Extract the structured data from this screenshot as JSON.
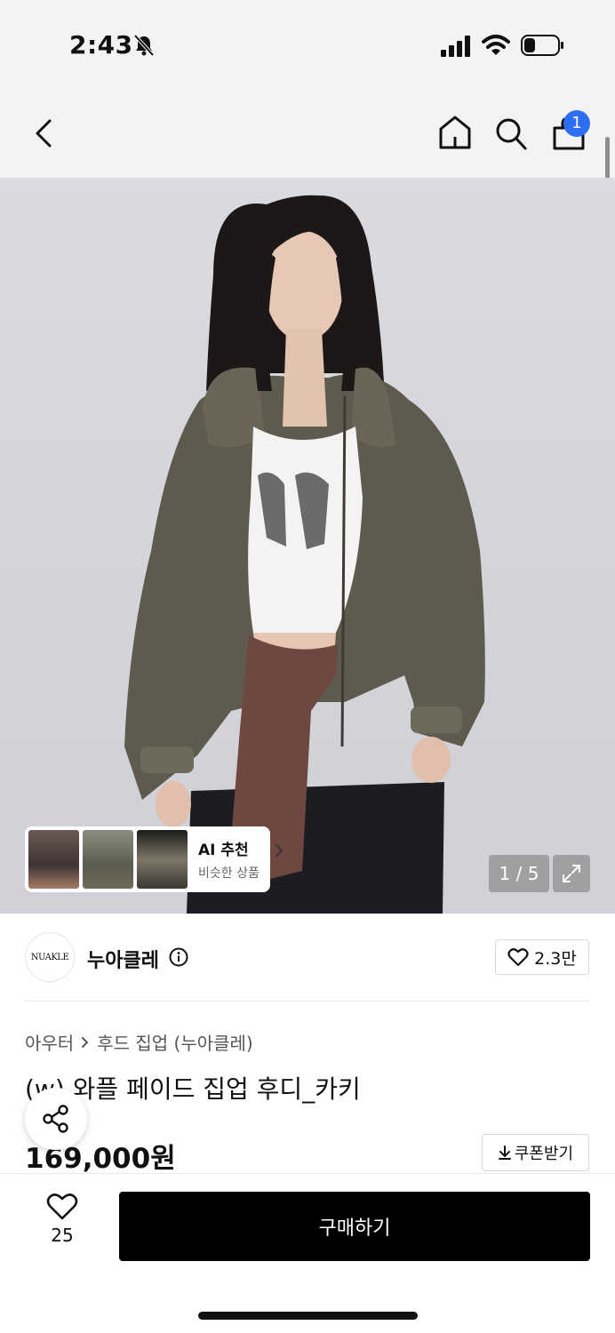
{
  "status_bar": {
    "time": "2:43"
  },
  "header": {
    "cart_count": "1"
  },
  "hero": {
    "ai_card": {
      "title": "AI 추천",
      "subtitle": "비슷한 상품"
    },
    "page_counter": "1 / 5"
  },
  "brand": {
    "logo_text": "NUAKLE",
    "name": "누아클레",
    "likes": "2.3만"
  },
  "breadcrumb": [
    "아우터",
    "후드 집업 (누아클레)"
  ],
  "product": {
    "title": "(w) 와플 페이드 집업 후디_카키",
    "price": "169,000원",
    "coupon_label": "쿠폰받기"
  },
  "bottom_bar": {
    "wish_count": "25",
    "buy_label": "구매하기"
  },
  "colors": {
    "accent": "#2e6ff2",
    "buy_button": "#000000"
  },
  "icons": [
    "bell-off-icon",
    "signal-icon",
    "wifi-icon",
    "battery-icon",
    "back-icon",
    "home-icon",
    "search-icon",
    "shopping-bag-icon",
    "chevron-right-icon",
    "expand-icon",
    "info-icon",
    "heart-icon",
    "share-icon",
    "download-icon"
  ]
}
